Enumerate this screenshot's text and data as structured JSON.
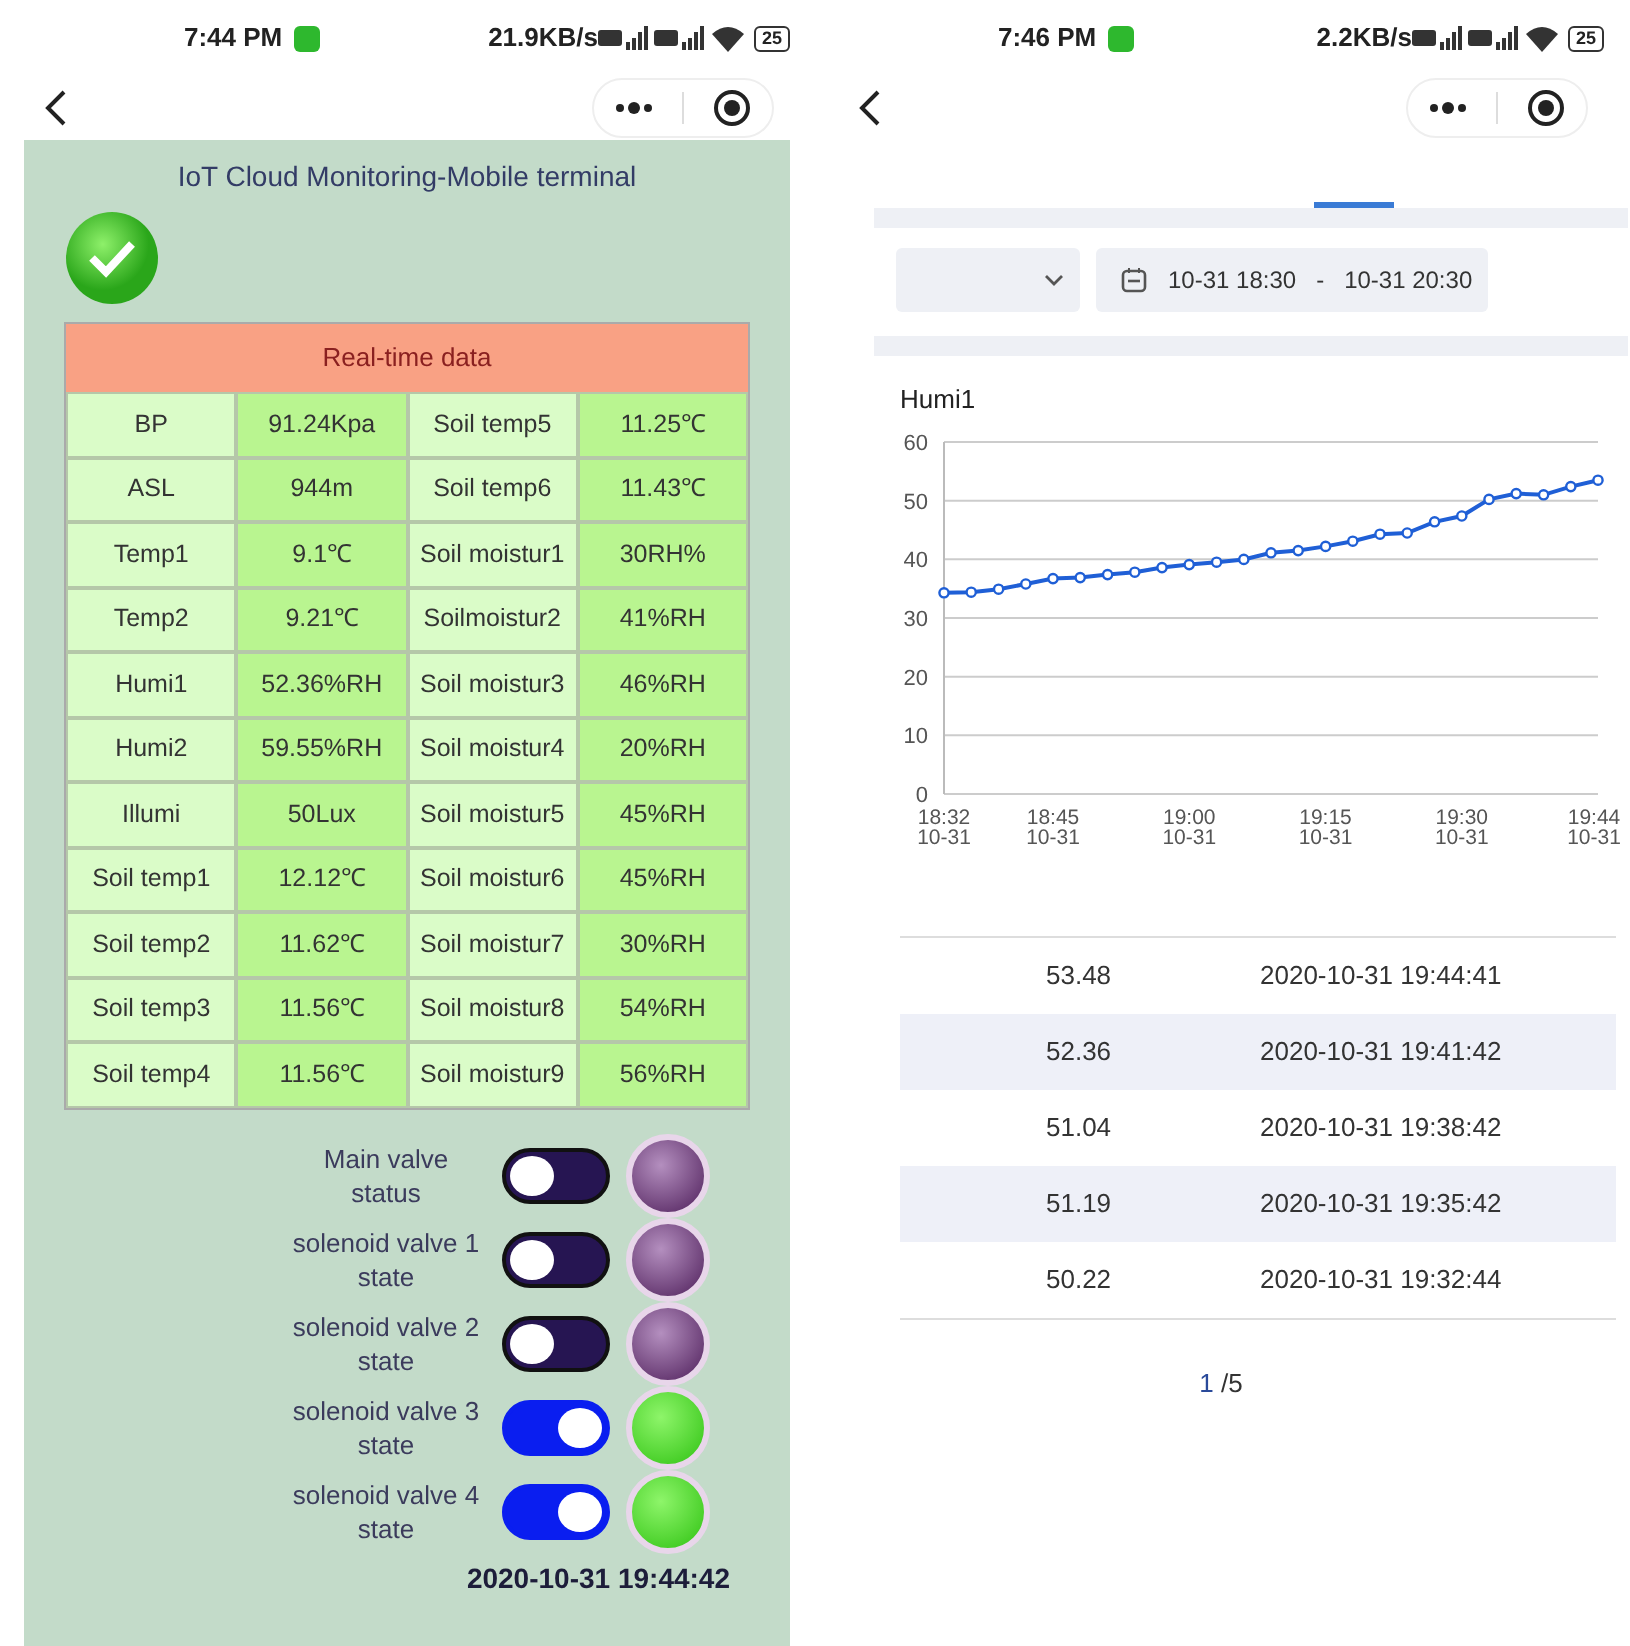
{
  "screens": [
    {
      "status_bar": {
        "time": "7:44 PM",
        "speed": "21.9KB/s",
        "battery": "25"
      },
      "title": "IoT Cloud Monitoring-Mobile terminal",
      "connected": true,
      "table": {
        "header": "Real-time data",
        "rows": [
          [
            "BP",
            "91.24Kpa",
            "Soil temp5",
            "11.25℃"
          ],
          [
            "ASL",
            "944m",
            "Soil temp6",
            "11.43℃"
          ],
          [
            "Temp1",
            "9.1℃",
            "Soil moistur1",
            "30RH%"
          ],
          [
            "Temp2",
            "9.21℃",
            "Soilmoistur2",
            "41%RH"
          ],
          [
            "Humi1",
            "52.36%RH",
            "Soil moistur3",
            "46%RH"
          ],
          [
            "Humi2",
            "59.55%RH",
            "Soil moistur4",
            "20%RH"
          ],
          [
            "Illumi",
            "50Lux",
            "Soil moistur5",
            "45%RH"
          ],
          [
            "Soil temp1",
            "12.12℃",
            "Soil moistur6",
            "45%RH"
          ],
          [
            "Soil temp2",
            "11.62℃",
            "Soil moistur7",
            "30%RH"
          ],
          [
            "Soil temp3",
            "11.56℃",
            "Soil moistur8",
            "54%RH"
          ],
          [
            "Soil temp4",
            "11.56℃",
            "Soil moistur9",
            "56%RH"
          ]
        ]
      },
      "valves": [
        {
          "label": "Main valve status",
          "on": false
        },
        {
          "label": "solenoid valve 1 state",
          "on": false
        },
        {
          "label": "solenoid valve 2 state",
          "on": false
        },
        {
          "label": "solenoid valve 3 state",
          "on": true
        },
        {
          "label": "solenoid valve 4 state",
          "on": true
        }
      ],
      "timestamp": "2020-10-31 19:44:42"
    },
    {
      "status_bar": {
        "time": "7:46 PM",
        "speed": "2.2KB/s",
        "battery": "25"
      },
      "range": {
        "start": "10-31 18:30",
        "separator": "-",
        "end": "10-31 20:30"
      },
      "chart_data": {
        "type": "line",
        "title": "Humi1",
        "categories": [
          "18:32 10-31",
          null,
          null,
          null,
          "18:45 10-31",
          null,
          null,
          null,
          null,
          "19:00 10-31",
          null,
          null,
          null,
          null,
          "19:15 10-31",
          null,
          null,
          null,
          null,
          "19:30 10-31",
          null,
          null,
          null,
          null,
          "19:44 10-31"
        ],
        "grid": true,
        "series": [
          {
            "color": "#1f5fd6",
            "marker": true,
            "values": [
              34.3,
              34.4,
              34.9,
              35.8,
              36.7,
              36.9,
              37.4,
              37.8,
              38.6,
              39.1,
              39.5,
              40.0,
              41.1,
              41.5,
              42.2,
              43.1,
              44.3,
              44.5,
              46.4,
              47.4,
              50.2,
              51.2,
              51.0,
              52.4,
              53.5
            ]
          }
        ],
        "ylim": [
          0,
          60
        ],
        "yticks": [
          0,
          10,
          20,
          30,
          40,
          50,
          60
        ]
      },
      "records": [
        [
          "53.48",
          "2020-10-31 19:44:41"
        ],
        [
          "52.36",
          "2020-10-31 19:41:42"
        ],
        [
          "51.04",
          "2020-10-31 19:38:42"
        ],
        [
          "51.19",
          "2020-10-31 19:35:42"
        ],
        [
          "50.22",
          "2020-10-31 19:32:44"
        ]
      ],
      "pager": {
        "current": "1",
        "total": "/5"
      }
    }
  ]
}
